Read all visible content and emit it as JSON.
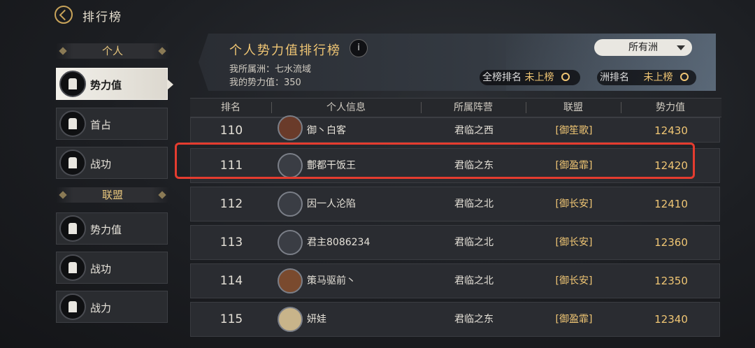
{
  "header": {
    "title": "排行榜"
  },
  "sidebar": {
    "personal_label": "个人",
    "personal_items": [
      {
        "label": "势力值",
        "active": true
      },
      {
        "label": "首占",
        "active": false
      },
      {
        "label": "战功",
        "active": false
      }
    ],
    "alliance_label": "联盟",
    "alliance_items": [
      {
        "label": "势力值"
      },
      {
        "label": "战功"
      },
      {
        "label": "战力"
      }
    ]
  },
  "panel": {
    "title": "个人势力值排行榜",
    "info": "i",
    "region_line": "我所属洲：七水流域",
    "power_line": "我的势力值：350",
    "dropdown_value": "所有洲",
    "overall_rank_label": "全榜排名",
    "overall_rank_value": "未上榜",
    "region_rank_label": "洲排名",
    "region_rank_value": "未上榜"
  },
  "table": {
    "columns": [
      "排名",
      "个人信息",
      "所属阵营",
      "联盟",
      "势力值"
    ],
    "rows": [
      {
        "rank": "110",
        "name": "御丶白客",
        "camp": "君临之西",
        "alliance": "[御笙歌]",
        "power": "12430"
      },
      {
        "rank": "111",
        "name": "鄷都干饭王",
        "camp": "君临之东",
        "alliance": "[御盈霏]",
        "power": "12420"
      },
      {
        "rank": "112",
        "name": "因一人沦陷",
        "camp": "君临之北",
        "alliance": "[御长安]",
        "power": "12410"
      },
      {
        "rank": "113",
        "name": "君主8086234",
        "camp": "君临之北",
        "alliance": "[御长安]",
        "power": "12360"
      },
      {
        "rank": "114",
        "name": "策马驱前丶",
        "camp": "君临之北",
        "alliance": "[御长安]",
        "power": "12350"
      },
      {
        "rank": "115",
        "name": "妍娃",
        "camp": "君临之东",
        "alliance": "[御盈霏]",
        "power": "12340"
      }
    ]
  },
  "colors": {
    "accent": "#f0c674",
    "highlight": "#e53c2f"
  }
}
